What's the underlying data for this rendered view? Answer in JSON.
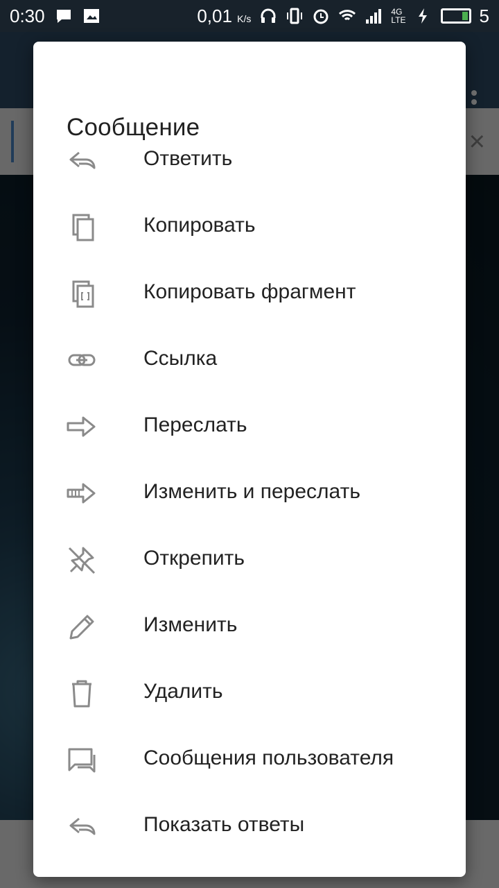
{
  "status_bar": {
    "time": "0:30",
    "speed": "0,01",
    "speed_unit": "K/s",
    "network": "4G",
    "network_sub": "LTE",
    "battery": "5",
    "colors": {
      "background": "#18222b",
      "text": "#ffffff",
      "battery_charge": "#4caf50"
    }
  },
  "pinned": {
    "close_icon": "close-icon"
  },
  "dialog": {
    "title": "Сообщение",
    "items": [
      {
        "label": "Ответить",
        "icon": "reply-icon"
      },
      {
        "label": "Копировать",
        "icon": "copy-icon"
      },
      {
        "label": "Копировать фрагмент",
        "icon": "copy-fragment-icon"
      },
      {
        "label": "Ссылка",
        "icon": "link-icon"
      },
      {
        "label": "Переслать",
        "icon": "forward-icon"
      },
      {
        "label": "Изменить и переслать",
        "icon": "edit-forward-icon"
      },
      {
        "label": "Открепить",
        "icon": "unpin-icon"
      },
      {
        "label": "Изменить",
        "icon": "pencil-icon"
      },
      {
        "label": "Удалить",
        "icon": "trash-icon"
      },
      {
        "label": "Сообщения пользователя",
        "icon": "user-messages-icon"
      },
      {
        "label": "Показать ответы",
        "icon": "reply-icon"
      }
    ]
  },
  "colors": {
    "dialog_bg": "#ffffff",
    "text": "#222222",
    "icon": "#8a8a8a"
  }
}
